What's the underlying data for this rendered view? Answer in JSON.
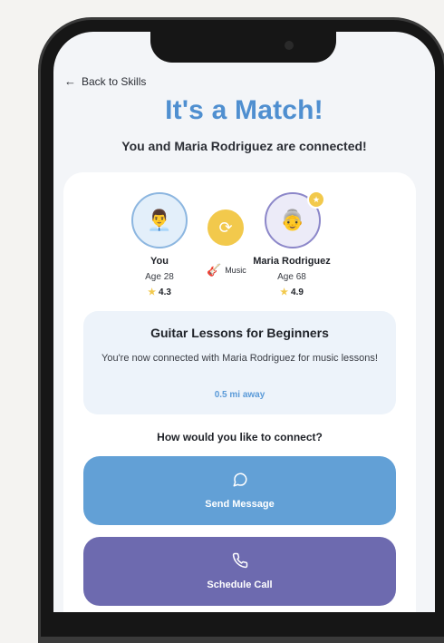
{
  "nav": {
    "back_label": "Back to Skills"
  },
  "header": {
    "title": "It's a Match!",
    "subtitle": "You and Maria Rodriguez are connected!"
  },
  "match": {
    "you": {
      "avatar_icon": "man-icon",
      "name": "You",
      "age": "Age 28",
      "rating": "4.3"
    },
    "partner": {
      "avatar_icon": "older-woman-icon",
      "name": "Maria Rodriguez",
      "age": "Age 68",
      "rating": "4.9"
    },
    "skill_icon": "guitar-icon",
    "skill_label": "Music"
  },
  "lesson": {
    "title": "Guitar Lessons for Beginners",
    "description": "You're now connected with Maria Rodriguez for music lessons!",
    "distance": "0.5 mi away"
  },
  "connect": {
    "question": "How would you like to connect?",
    "message_label": "Send Message",
    "call_label": "Schedule Call"
  },
  "colors": {
    "accent_blue": "#4f8fd0",
    "message_button": "#62a0d6",
    "call_button": "#6d6aaf",
    "star": "#f2c94c"
  }
}
